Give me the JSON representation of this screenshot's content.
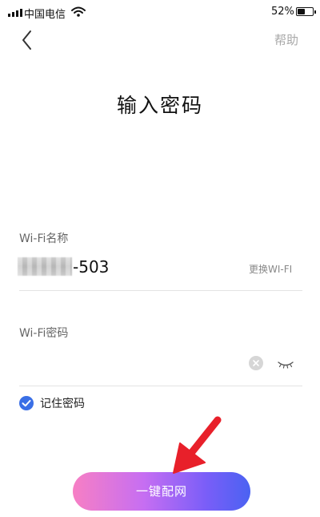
{
  "status_bar": {
    "carrier": "中国电信",
    "battery": "52%",
    "battery_level": 0.52,
    "wifi_icon": "wifi-icon",
    "signal_icon": "signal-icon"
  },
  "nav": {
    "back_icon": "chevron-left-icon",
    "help": "帮助"
  },
  "title": "输入密码",
  "wifi_name": {
    "label": "Wi-Fi名称",
    "value": "-503",
    "change": "更换WI-FI"
  },
  "wifi_password": {
    "label": "Wi-Fi密码",
    "value": "",
    "clear_icon": "clear-icon",
    "eye_icon": "eye-closed-icon"
  },
  "remember": {
    "label": "记住密码",
    "checked": true
  },
  "connect_button": {
    "label": "一键配网"
  },
  "colors": {
    "accent": "#3a6fe6",
    "arrow": "#e8202a",
    "button_gradient": [
      "#f77fc4",
      "#c66ef2",
      "#7a5ef8",
      "#4a62f2"
    ]
  }
}
